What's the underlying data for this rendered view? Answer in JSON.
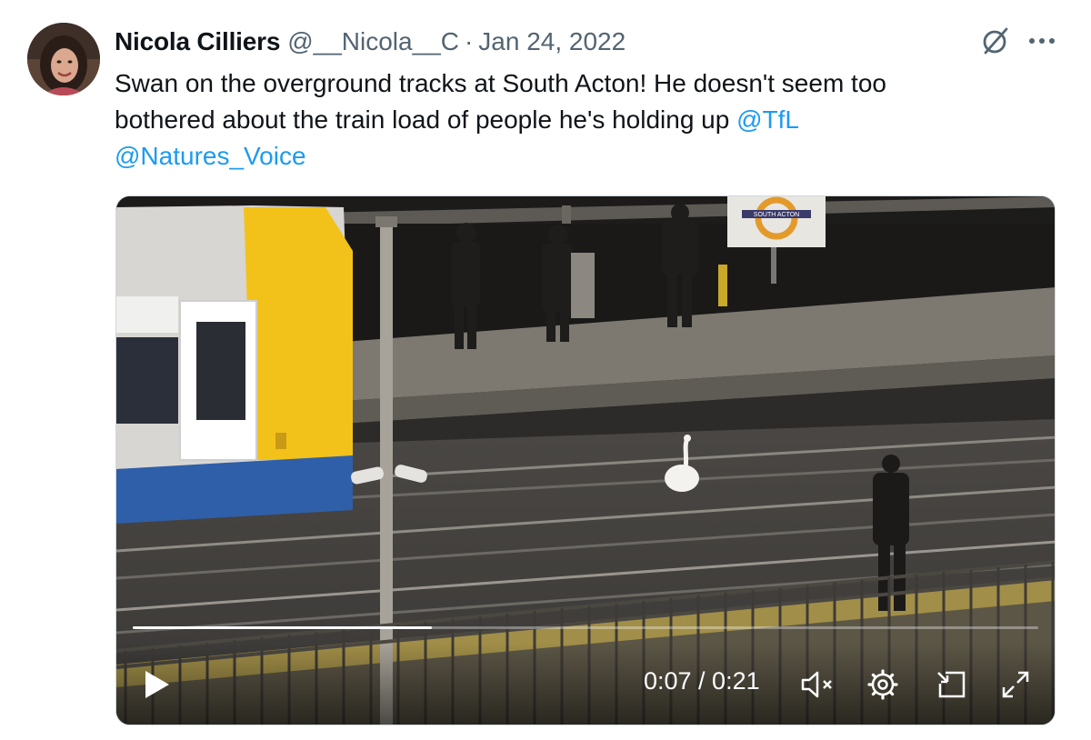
{
  "tweet": {
    "author_name": "Nicola Cilliers",
    "handle": "@__Nicola__C",
    "separator": "·",
    "date": "Jan 24, 2022",
    "text_line1": "Swan on the overground tracks at South Acton! He doesn't seem too",
    "text_line2_prefix": "bothered about the train load of people he's holding up ",
    "mention1": "@TfL",
    "mention2": "@Natures_Voice"
  },
  "top_icons": [
    "grok-icon",
    "more-icon"
  ],
  "video": {
    "station_sign": "SOUTH ACTON",
    "current_time": "0:07",
    "duration": "0:21",
    "time_display": "0:07 / 0:21",
    "progress": 0.33,
    "icons": [
      "play-icon",
      "mute-icon",
      "settings-icon",
      "pip-icon",
      "fullscreen-icon"
    ]
  },
  "colors": {
    "link": "#1d9bf0",
    "secondary_text": "#536471",
    "primary_text": "#0f1419",
    "train_yellow": "#f2c21b",
    "train_blue": "#2f5fa8"
  }
}
